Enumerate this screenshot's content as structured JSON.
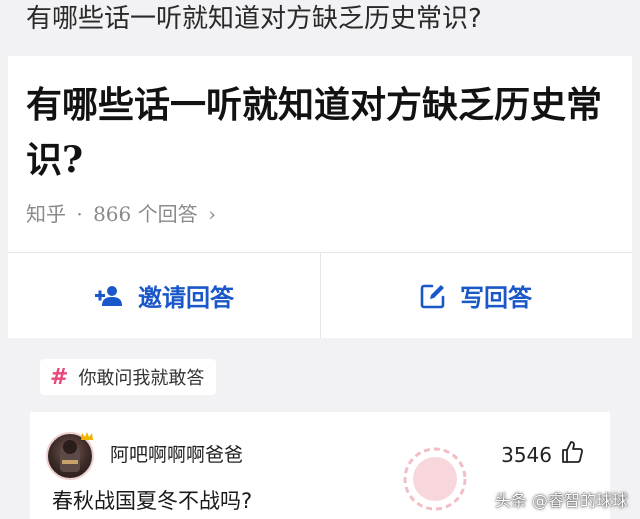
{
  "page_title": "有哪些话一听就知道对方缺乏历史常识?",
  "question": {
    "title": "有哪些话一听就知道对方缺乏历史常识?",
    "source": "知乎",
    "dot": "·",
    "answer_count": "866 个回答",
    "chevron": "›"
  },
  "actions": {
    "invite_label": "邀请回答",
    "write_label": "写回答"
  },
  "topic": {
    "hash": "#",
    "label": "你敢问我就敢答"
  },
  "answer": {
    "author": "阿吧啊啊啊爸爸",
    "votes": "3546",
    "text": "春秋战国夏冬不战吗?"
  },
  "watermark": "头条 @睿智的球球",
  "colors": {
    "accent_blue": "#1a57c8",
    "topic_pink": "#e8477a",
    "background": "#f2f2f4"
  },
  "icons": {
    "invite": "add-person-icon",
    "write": "edit-icon",
    "vote": "thumbs-up-icon"
  }
}
